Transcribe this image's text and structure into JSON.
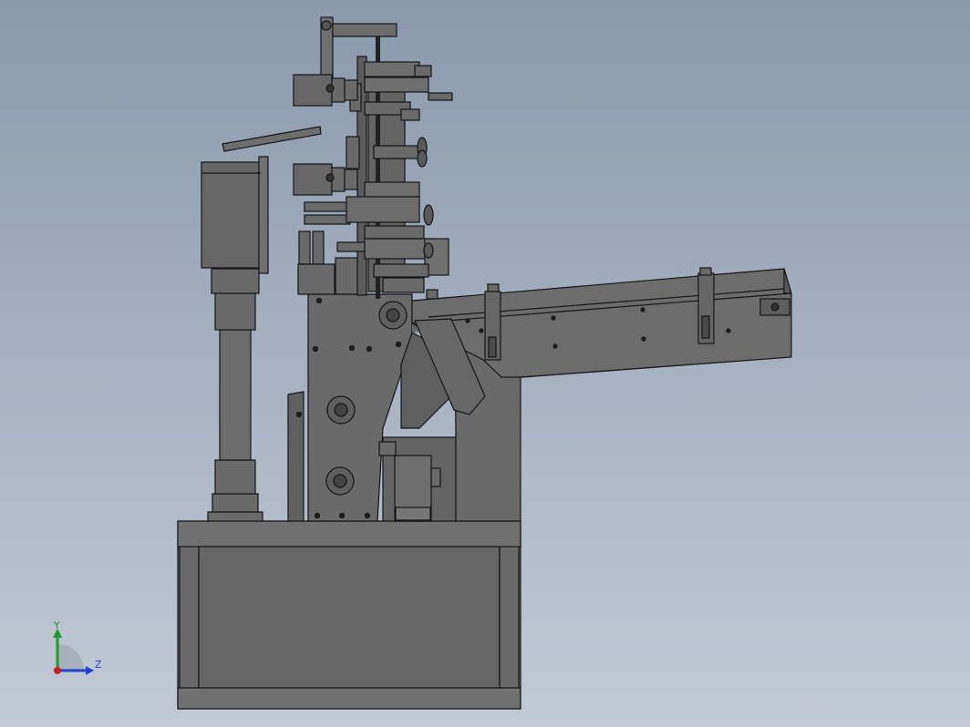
{
  "viewport": {
    "background_top": "#8a99ad",
    "background_bottom": "#c3cad6",
    "part_fill": "#6a6a6a",
    "part_dark": "#555555",
    "part_light": "#7a7a7a",
    "edge": "#151515"
  },
  "triad": {
    "y_label": "Y",
    "z_label": "Z",
    "y_color": "#1f9a2a",
    "z_color": "#1f3fd0",
    "x_color": "#c4201e"
  }
}
